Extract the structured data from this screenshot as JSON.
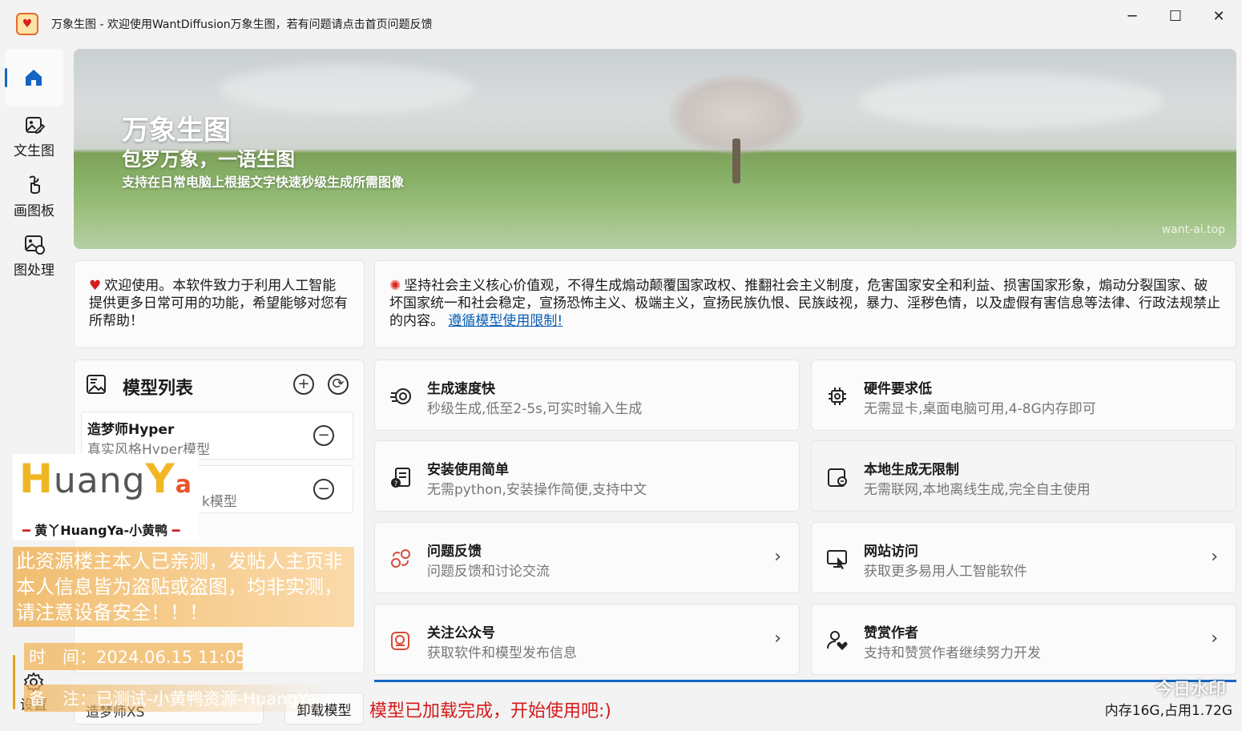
{
  "window": {
    "app_name": "万象生图",
    "title": "万象生图  -  欢迎使用WantDiffusion万象生图，若有问题请点击首页问题反馈",
    "min_glyph": "─",
    "max_glyph": "☐",
    "close_glyph": "✕"
  },
  "rail": {
    "items": [
      {
        "label": "",
        "icon": "home-icon"
      },
      {
        "label": "文生图",
        "icon": "image-edit-icon"
      },
      {
        "label": "画图板",
        "icon": "hand-draw-icon"
      },
      {
        "label": "图处理",
        "icon": "image-process-icon"
      }
    ],
    "settings_label": "设置"
  },
  "banner": {
    "title": "万象生图",
    "subtitle": "包罗万象，一语生图",
    "tagline": "支持在日常电脑上根据文字快速秒级生成所需图像",
    "site": "want-ai.top"
  },
  "welcome": {
    "heart": "♥",
    "text": "欢迎使用。本软件致力于利用人工智能提供更多日常可用的功能，希望能够对您有所帮助！"
  },
  "policy": {
    "text": "坚持社会主义核心价值观，不得生成煽动颠覆国家政权、推翻社会主义制度，危害国家安全和利益、损害国家形象，煽动分裂国家、破坏国家统一和社会稳定，宣扬恐怖主义、极端主义，宣扬民族仇恨、民族歧视，暴力、淫秽色情，以及虚假有害信息等法律、行政法规禁止的内容。",
    "link": "遵循模型使用限制!"
  },
  "models": {
    "title": "模型列表",
    "add_glyph": "+",
    "refresh_glyph": "⟳",
    "remove_glyph": "−",
    "items": [
      {
        "name": "造梦师Hyper",
        "desc": "真实风格Hyper模型"
      },
      {
        "name": "",
        "desc": "k模型"
      }
    ]
  },
  "features": [
    {
      "title": "生成速度快",
      "desc": "秒级生成,低至2-5s,可实时输入生成",
      "icon": "speed-icon",
      "chevron": ""
    },
    {
      "title": "硬件要求低",
      "desc": "无需显卡,桌面电脑可用,4-8G内存即可",
      "icon": "chip-icon",
      "chevron": ""
    },
    {
      "title": "安装使用简单",
      "desc": "无需python,安装操作简便,支持中文",
      "icon": "install-icon",
      "chevron": ""
    },
    {
      "title": "本地生成无限制",
      "desc": "无需联网,本地离线生成,完全自主使用",
      "icon": "local-icon",
      "chevron": ""
    },
    {
      "title": "问题反馈",
      "desc": "问题反馈和讨论交流",
      "icon": "feedback-icon",
      "chevron": "›"
    },
    {
      "title": "网站访问",
      "desc": "获取更多易用人工智能软件",
      "icon": "website-icon",
      "chevron": "›"
    },
    {
      "title": "关注公众号",
      "desc": "获取软件和模型发布信息",
      "icon": "wechat-icon",
      "chevron": "›"
    },
    {
      "title": "赞赏作者",
      "desc": "支持和赞赏作者继续努力开发",
      "icon": "donate-icon",
      "chevron": "›"
    }
  ],
  "bottom": {
    "model_select": "造梦师XS",
    "unload": "卸载模型",
    "status": "模型已加载完成，开始使用吧:)",
    "memory": "内存16G,占用1.72G"
  },
  "watermark": {
    "logo_h": "H",
    "logo_uang": "uang",
    "logo_y": "Y",
    "logo_a": "a",
    "logo_sub": "黄丫HuangYa-小黄鸭",
    "notice": "此资源楼主本人已亲测，发帖人主页非本人信息皆为盗贴或盗图，均非实测，请注意设备安全！！！",
    "time": "时　间：2024.06.15 11:05",
    "note": "备　注：已测试-小黄鸭资源-HuangYa",
    "corner": "今日水印"
  },
  "colors": {
    "accent": "#1565c0",
    "status_red": "#d41b1b",
    "link": "#0a5fb4"
  }
}
